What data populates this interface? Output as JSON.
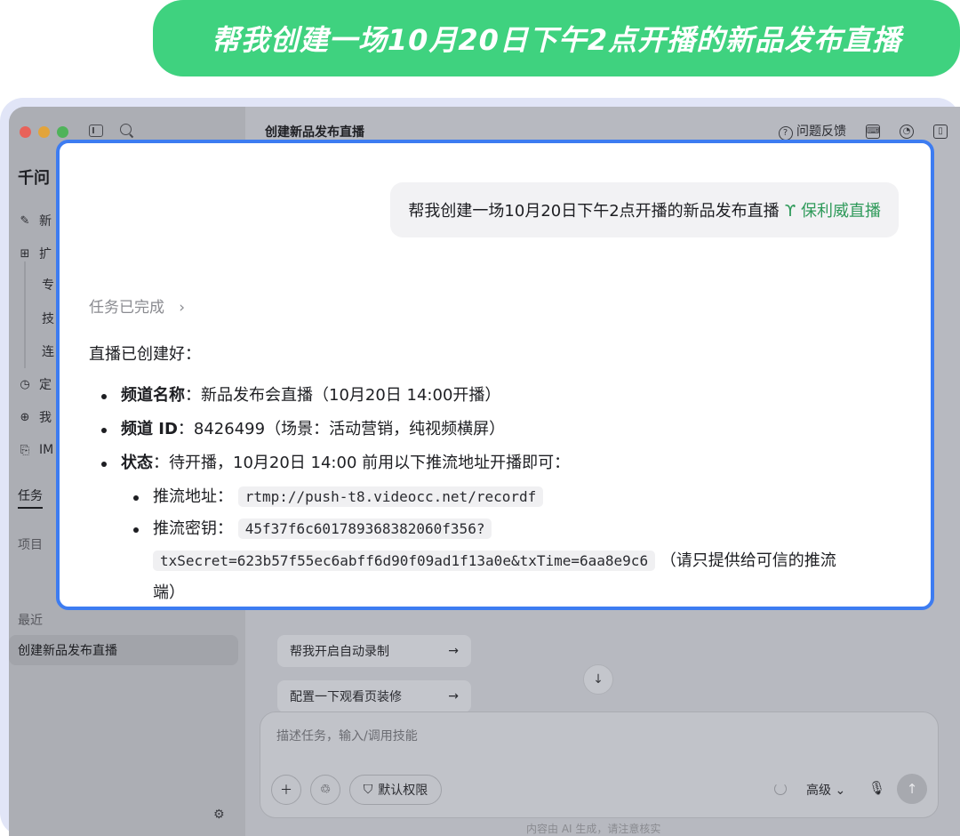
{
  "banner": {
    "text": "帮我创建一场10月20日下午2点开播的新品发布直播"
  },
  "sidebar": {
    "app_name": "千问",
    "items": [
      {
        "icon": "edit-icon",
        "glyph": "✎",
        "label": "新"
      },
      {
        "icon": "extensions-icon",
        "glyph": "⊞",
        "label": "扩"
      }
    ],
    "sub_items": [
      "专",
      "技",
      "连"
    ],
    "items2": [
      {
        "icon": "clock-icon",
        "glyph": "◷",
        "label": "定"
      },
      {
        "icon": "globe-icon",
        "glyph": "⊕",
        "label": "我"
      },
      {
        "icon": "im-icon",
        "glyph": "⎘",
        "label": "IM"
      }
    ],
    "tab_tasks": "任务",
    "tab_projects": "项目",
    "recent_label": "最近",
    "recent_item": "创建新品发布直播"
  },
  "header": {
    "title": "创建新品发布直播",
    "feedback_label": "问题反馈"
  },
  "popup": {
    "user_message": "帮我创建一场10月20日下午2点开播的新品发布直播",
    "skill_name": "保利威直播",
    "task_status": "任务已完成",
    "intro": "直播已创建好：",
    "channel_name_label": "频道名称",
    "channel_name_value": "：新品发布会直播（10月20日 14:00开播）",
    "channel_id_label": "频道 ID",
    "channel_id_value": "：8426499（场景：活动营销，纯视频横屏）",
    "status_label": "状态",
    "status_value": "：待开播，10月20日 14:00 前用以下推流地址开播即可：",
    "push_url_label": "推流地址：",
    "push_url_value": "rtmp://push-t8.videocc.net/recordf",
    "push_key_label": "推流密钥：",
    "push_key_value_1": "45f37f6c601789368382060f356?",
    "push_key_value_2": "txSecret=623b57f55ec6abff6d90f09ad1f13a0e&txTime=6aa8e9c6",
    "push_key_note": "（请只提供给可信的推流",
    "push_key_note_2": "端）"
  },
  "suggestions": [
    "帮我开启自动录制",
    "配置一下观看页装修"
  ],
  "composer": {
    "placeholder": "描述任务，输入/调用技能",
    "permission_label": "默认权限",
    "advanced_label": "高级",
    "disclaimer": "内容由 AI 生成，请注意核实"
  }
}
